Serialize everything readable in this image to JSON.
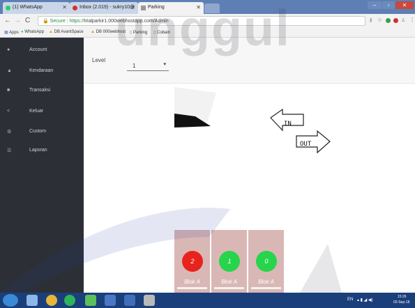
{
  "browser": {
    "tabs": [
      {
        "label": "(1) WhatsApp",
        "icon": "whatsapp-icon"
      },
      {
        "label": "Inbox (2.019) - sukry10@",
        "icon": "gmail-icon"
      },
      {
        "label": "Parking",
        "icon": "page-icon"
      }
    ],
    "url_secure": "Secure",
    "url_proto": "https://",
    "url_rest": "trialparkir1.000webhostapp.com/Admin",
    "bookmarks": [
      "Apps",
      "WhatsApp",
      "DB AvantSpace",
      "DB 000webhost",
      "Parking",
      "Cobain"
    ]
  },
  "sidebar": {
    "items": [
      {
        "label": "Account",
        "icon": "user-icon"
      },
      {
        "label": "Kendaraan",
        "icon": "car-icon"
      },
      {
        "label": "Transaksi",
        "icon": "shopping-icon"
      },
      {
        "label": "Keluar",
        "icon": "logout-icon"
      },
      {
        "label": "Custom",
        "icon": "gears-icon"
      },
      {
        "label": "Laporan",
        "icon": "list-icon"
      }
    ]
  },
  "filter": {
    "level_label": "Level",
    "level_value": "1"
  },
  "watermark": "unggul",
  "arrows": {
    "in_label": "IN",
    "out_label": "OUT"
  },
  "slots": [
    {
      "count": "2",
      "blok": "Blok A",
      "color": "#e8231d"
    },
    {
      "count": "1",
      "blok": "Blok A",
      "color": "#27d44c"
    },
    {
      "count": "0",
      "blok": "Blok A",
      "color": "#27d44c"
    }
  ],
  "taskbar": {
    "lang": "EN",
    "time": "15:26",
    "date": "02-Sep-18"
  },
  "colors": {
    "sidebar_bg": "#2c3036",
    "slot_bg": "#d9b7b5",
    "full": "#e8231d",
    "available": "#27d44c"
  }
}
